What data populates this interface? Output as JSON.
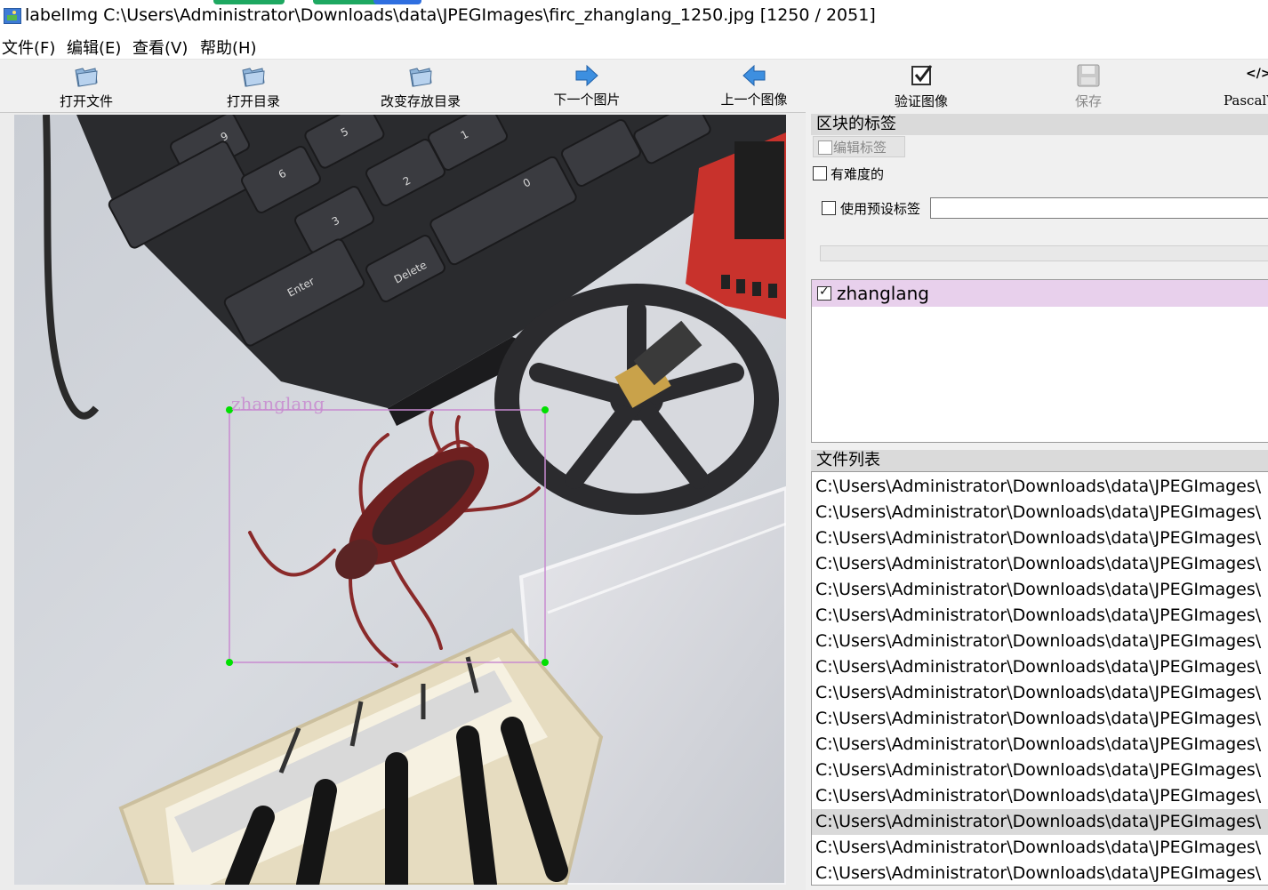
{
  "window": {
    "title": "labelImg C:\\Users\\Administrator\\Downloads\\data\\JPEGImages\\firc_zhanglang_1250.jpg [1250 / 2051]"
  },
  "menu": {
    "items": [
      "文件(F)",
      "编辑(E)",
      "查看(V)",
      "帮助(H)"
    ]
  },
  "toolbar": {
    "open_file": "打开文件",
    "open_dir": "打开目录",
    "change_save_dir": "改变存放目录",
    "next_image": "下一个图片",
    "prev_image": "上一个图像",
    "verify_image": "验证图像",
    "save": "保存",
    "format": "PascalVOC",
    "format_icon": "</>"
  },
  "canvas": {
    "box_label": "zhanglang",
    "box_color": "#c88ad0",
    "handle_color": "#00e000"
  },
  "dock": {
    "box_labels_title": "区块的标签",
    "edit_label_button": "编辑标签",
    "difficult_label": "有难度的",
    "difficult_checked": false,
    "use_default_label": "使用预设标签",
    "use_default_checked": false,
    "default_label_value": "",
    "labels": [
      {
        "name": "zhanglang",
        "checked": true
      }
    ],
    "file_list_title": "文件列表",
    "files": [
      "C:\\Users\\Administrator\\Downloads\\data\\JPEGImages\\",
      "C:\\Users\\Administrator\\Downloads\\data\\JPEGImages\\",
      "C:\\Users\\Administrator\\Downloads\\data\\JPEGImages\\",
      "C:\\Users\\Administrator\\Downloads\\data\\JPEGImages\\",
      "C:\\Users\\Administrator\\Downloads\\data\\JPEGImages\\",
      "C:\\Users\\Administrator\\Downloads\\data\\JPEGImages\\",
      "C:\\Users\\Administrator\\Downloads\\data\\JPEGImages\\",
      "C:\\Users\\Administrator\\Downloads\\data\\JPEGImages\\",
      "C:\\Users\\Administrator\\Downloads\\data\\JPEGImages\\",
      "C:\\Users\\Administrator\\Downloads\\data\\JPEGImages\\",
      "C:\\Users\\Administrator\\Downloads\\data\\JPEGImages\\",
      "C:\\Users\\Administrator\\Downloads\\data\\JPEGImages\\",
      "C:\\Users\\Administrator\\Downloads\\data\\JPEGImages\\",
      "C:\\Users\\Administrator\\Downloads\\data\\JPEGImages\\",
      "C:\\Users\\Administrator\\Downloads\\data\\JPEGImages\\",
      "C:\\Users\\Administrator\\Downloads\\data\\JPEGImages\\"
    ],
    "selected_file_index": 13
  }
}
